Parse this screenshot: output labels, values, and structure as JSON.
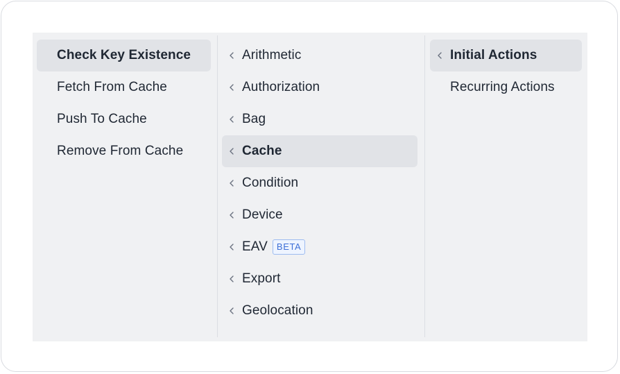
{
  "columns": {
    "left": {
      "items": [
        {
          "label": "Check Key Existence",
          "active": true
        },
        {
          "label": "Fetch From Cache",
          "active": false
        },
        {
          "label": "Push To Cache",
          "active": false
        },
        {
          "label": "Remove From Cache",
          "active": false
        }
      ]
    },
    "middle": {
      "items": [
        {
          "label": "Arithmetic",
          "active": false
        },
        {
          "label": "Authorization",
          "active": false
        },
        {
          "label": "Bag",
          "active": false
        },
        {
          "label": "Cache",
          "active": true
        },
        {
          "label": "Condition",
          "active": false
        },
        {
          "label": "Device",
          "active": false
        },
        {
          "label": "EAV",
          "active": false,
          "badge": "BETA"
        },
        {
          "label": "Export",
          "active": false
        },
        {
          "label": "Geolocation",
          "active": false
        }
      ]
    },
    "right": {
      "items": [
        {
          "label": "Initial Actions",
          "active": true
        },
        {
          "label": "Recurring Actions",
          "active": false
        }
      ]
    }
  },
  "icons": {
    "expand_indicator": "chevron-left-icon"
  },
  "colors": {
    "panel_background": "#f0f1f3",
    "active_background": "#e1e3e7",
    "text": "#1f2733",
    "badge_border": "#9dbbf0",
    "badge_text": "#3d6fd6"
  }
}
